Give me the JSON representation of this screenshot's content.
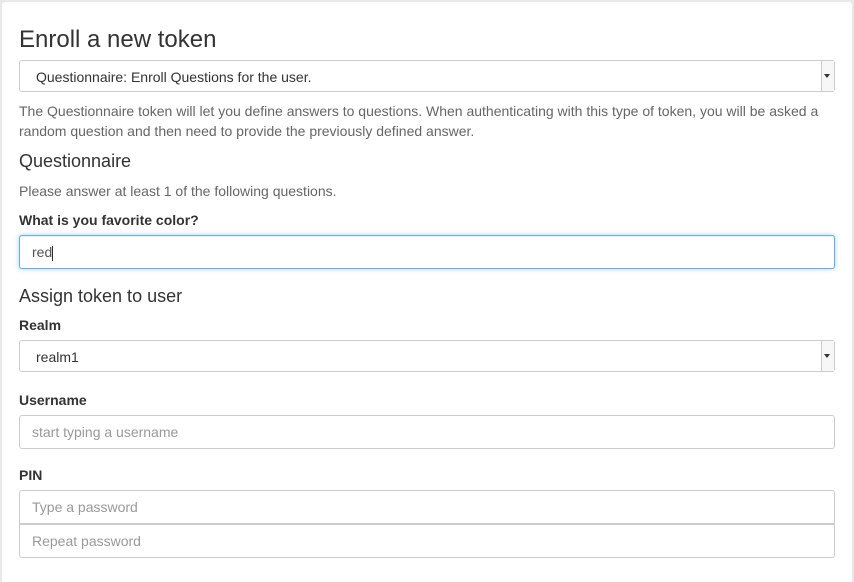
{
  "page": {
    "title": "Enroll a new token"
  },
  "token_type": {
    "selected": "Questionnaire: Enroll Questions for the user.",
    "description": "The Questionnaire token will let you define answers to questions. When authenticating with this type of token, you will be asked a random question and then need to provide the previously defined answer."
  },
  "questionnaire": {
    "heading": "Questionnaire",
    "instruction": "Please answer at least 1 of the following questions.",
    "question_label": "What is you favorite color?",
    "answer_value": "red"
  },
  "assign": {
    "heading": "Assign token to user",
    "realm_label": "Realm",
    "realm_selected": "realm1",
    "username_label": "Username",
    "username_placeholder": "start typing a username",
    "pin_label": "PIN",
    "pin_placeholder": "Type a password",
    "pin_repeat_placeholder": "Repeat password"
  },
  "colors": {
    "focus_border": "#66afe9",
    "border": "#cccccc",
    "text": "#333333",
    "muted": "#666666"
  }
}
